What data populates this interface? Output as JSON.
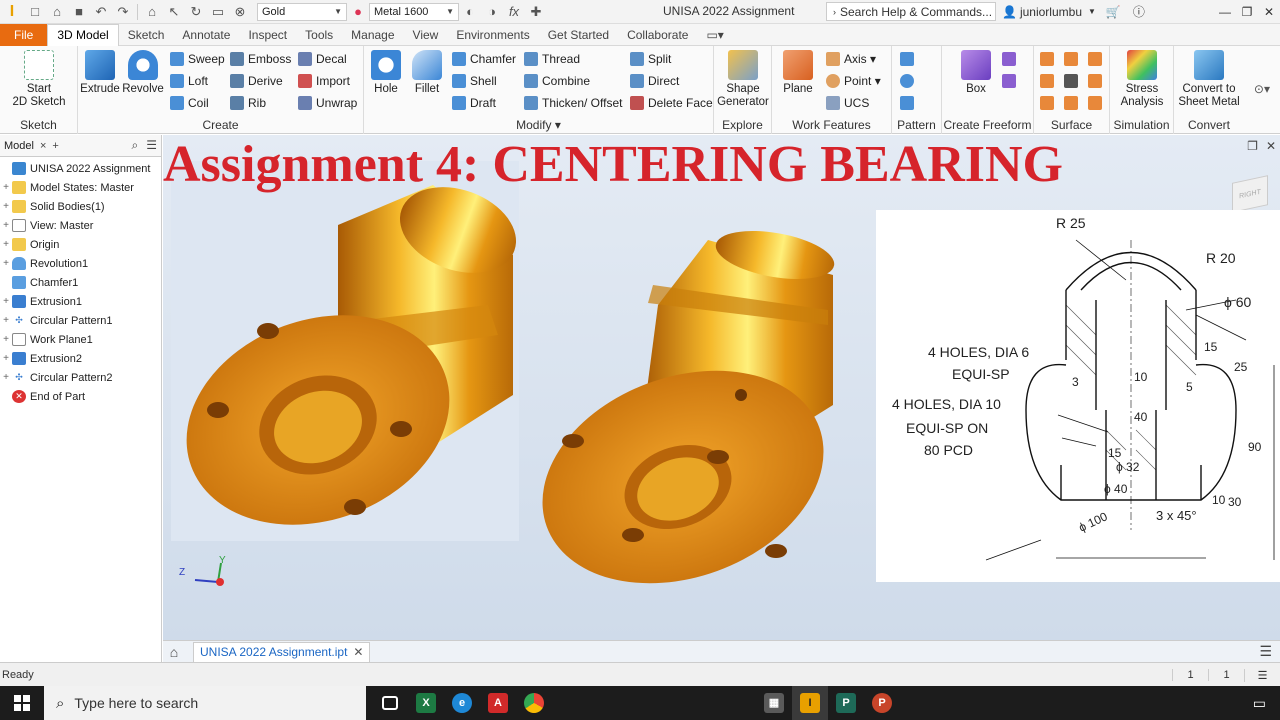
{
  "titlebar": {
    "material": "Gold",
    "appearance": "Metal 1600",
    "app_title": "UNISA 2022 Assignment",
    "search_placeholder": "Search Help & Commands...",
    "user": "juniorlumbu"
  },
  "tabs": [
    "File",
    "3D Model",
    "Sketch",
    "Annotate",
    "Inspect",
    "Tools",
    "Manage",
    "View",
    "Environments",
    "Get Started",
    "Collaborate"
  ],
  "active_tab": "3D Model",
  "ribbon": {
    "sketch": {
      "title": "Sketch",
      "start_sketch": "Start\n2D Sketch"
    },
    "create": {
      "title": "Create",
      "extrude": "Extrude",
      "revolve": "Revolve",
      "sweep": "Sweep",
      "loft": "Loft",
      "coil": "Coil",
      "emboss": "Emboss",
      "derive": "Derive",
      "rib": "Rib",
      "decal": "Decal",
      "import": "Import",
      "unwrap": "Unwrap"
    },
    "modify": {
      "title": "Modify",
      "hole": "Hole",
      "fillet": "Fillet",
      "chamfer": "Chamfer",
      "shell": "Shell",
      "draft": "Draft",
      "thread": "Thread",
      "combine": "Combine",
      "thicken": "Thicken/ Offset",
      "split": "Split",
      "direct": "Direct",
      "delete_face": "Delete Face"
    },
    "explore": {
      "title": "Explore",
      "shape_generator": "Shape\nGenerator"
    },
    "work_features": {
      "title": "Work Features",
      "plane": "Plane",
      "axis": "Axis",
      "point": "Point",
      "ucs": "UCS"
    },
    "pattern": {
      "title": "Pattern"
    },
    "freeform": {
      "title": "Create Freeform",
      "box": "Box"
    },
    "surface": {
      "title": "Surface"
    },
    "simulation": {
      "title": "Simulation",
      "stress": "Stress\nAnalysis"
    },
    "convert": {
      "title": "Convert",
      "sheet_metal": "Convert to\nSheet Metal"
    }
  },
  "browser": {
    "label": "Model",
    "items": [
      "UNISA 2022 Assignment",
      "Model States: Master",
      "Solid Bodies(1)",
      "View: Master",
      "Origin",
      "Revolution1",
      "Chamfer1",
      "Extrusion1",
      "Circular Pattern1",
      "Work Plane1",
      "Extrusion2",
      "Circular Pattern2",
      "End of Part"
    ]
  },
  "viewport": {
    "title": "Assignment 4: CENTERING BEARING",
    "viewcube_label": "RIGHT",
    "triad": {
      "x": "Z",
      "y": "Y"
    }
  },
  "drawing": {
    "r25": "R 25",
    "r20": "R 20",
    "phi60": "ϕ 60",
    "holes6": "4 HOLES, DIA 6",
    "equi_sp": "EQUI-SP",
    "holes10": "4 HOLES, DIA 10",
    "equi_sp_on": "EQUI-SP ON",
    "pcd": "80 PCD",
    "phi100": "ϕ 100",
    "phi40": "ϕ 40",
    "phi32": "ϕ 32",
    "chamfer": "3 x 45°",
    "d15": "15",
    "d25": "25",
    "d90": "90",
    "d30": "30",
    "d10a": "10",
    "d10b": "10",
    "d5": "5",
    "d3": "3",
    "d40": "40",
    "d15b": "15"
  },
  "doctab": {
    "name": "UNISA 2022 Assignment.ipt"
  },
  "status": {
    "text": "Ready",
    "count1": "1",
    "count2": "1"
  },
  "taskbar": {
    "search_placeholder": "Type here to search"
  },
  "colors": {
    "accent": "#e86b10",
    "title_red": "#d6242b",
    "gold": "#e29a12",
    "link": "#1a66c4"
  }
}
